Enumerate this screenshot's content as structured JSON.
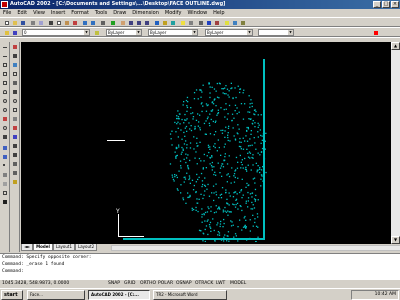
{
  "window": {
    "title": "AutoCAD 2002 - [C:\\Documents and Settings\\...\\Desktop\\FACE OUTLINE.dwg]",
    "min": "_",
    "max": "□",
    "close": "×"
  },
  "menu": [
    "File",
    "Edit",
    "View",
    "Insert",
    "Format",
    "Tools",
    "Draw",
    "Dimension",
    "Modify",
    "Window",
    "Help"
  ],
  "toolbar2": {
    "layer": "0",
    "color": "ByLayer",
    "linetype": "ByLayer",
    "lineweight": "ByLayer"
  },
  "toolbar3": {
    "textstyle": "Standard",
    "dimstyle": "ISO-25"
  },
  "tabs": [
    {
      "label": "Model",
      "active": true
    },
    {
      "label": "Layout1",
      "active": false
    },
    {
      "label": "Layout2",
      "active": false
    }
  ],
  "ucs_label": "Y",
  "command_lines": [
    "Command: Specify opposite corner:",
    "Command: _erase 1 found",
    "Command:"
  ],
  "status": {
    "coords": "1045.3428, 548.9873, 0.0000",
    "modes": [
      "SNAP",
      "GRID",
      "ORTHO",
      "POLAR",
      "OSNAP",
      "OTRACK",
      "LWT",
      "MODEL"
    ]
  },
  "taskbar": {
    "start": "start",
    "tasks": [
      {
        "label": "Face...",
        "active": false
      },
      {
        "label": "AutoCAD 2002 - [C:...",
        "active": true
      },
      {
        "label": "TR2 - Microsoft Word",
        "active": false
      }
    ],
    "clock": "10:42 AM"
  },
  "colors": {
    "titlebar": "#0a246a",
    "drawing_bg": "#000000",
    "face_dots": "#00c0c0",
    "accent_line": "#00c0c0"
  }
}
